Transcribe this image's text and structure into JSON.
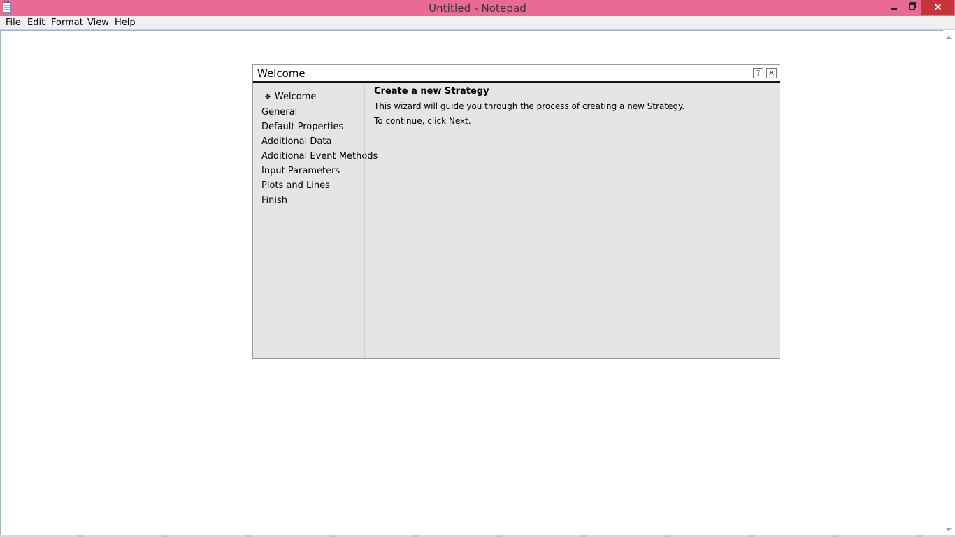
{
  "window": {
    "title": "Untitled - Notepad",
    "accent_color": "#e96b95",
    "close_color": "#c7333a",
    "icons": [
      "notepad-icon",
      "minimize-icon",
      "restore-icon",
      "close-icon"
    ]
  },
  "menubar": {
    "items": [
      {
        "label": "File"
      },
      {
        "label": "Edit"
      },
      {
        "label": "Format"
      },
      {
        "label": "View"
      },
      {
        "label": "Help"
      }
    ]
  },
  "dialog": {
    "title": "Welcome",
    "help_button_label": "?",
    "close_button_label": "✕",
    "nav": {
      "active_bullet": "❖",
      "items": [
        {
          "label": "Welcome"
        },
        {
          "label": "General"
        },
        {
          "label": "Default Properties"
        },
        {
          "label": "Additional Data"
        },
        {
          "label": "Additional Event Methods"
        },
        {
          "label": "Input Parameters"
        },
        {
          "label": "Plots and Lines"
        },
        {
          "label": "Finish"
        }
      ],
      "active_index": 0
    },
    "content": {
      "heading": "Create a new Strategy",
      "line1": "This wizard will guide you through the process of creating a new Strategy.",
      "line2": "To continue, click Next."
    }
  }
}
